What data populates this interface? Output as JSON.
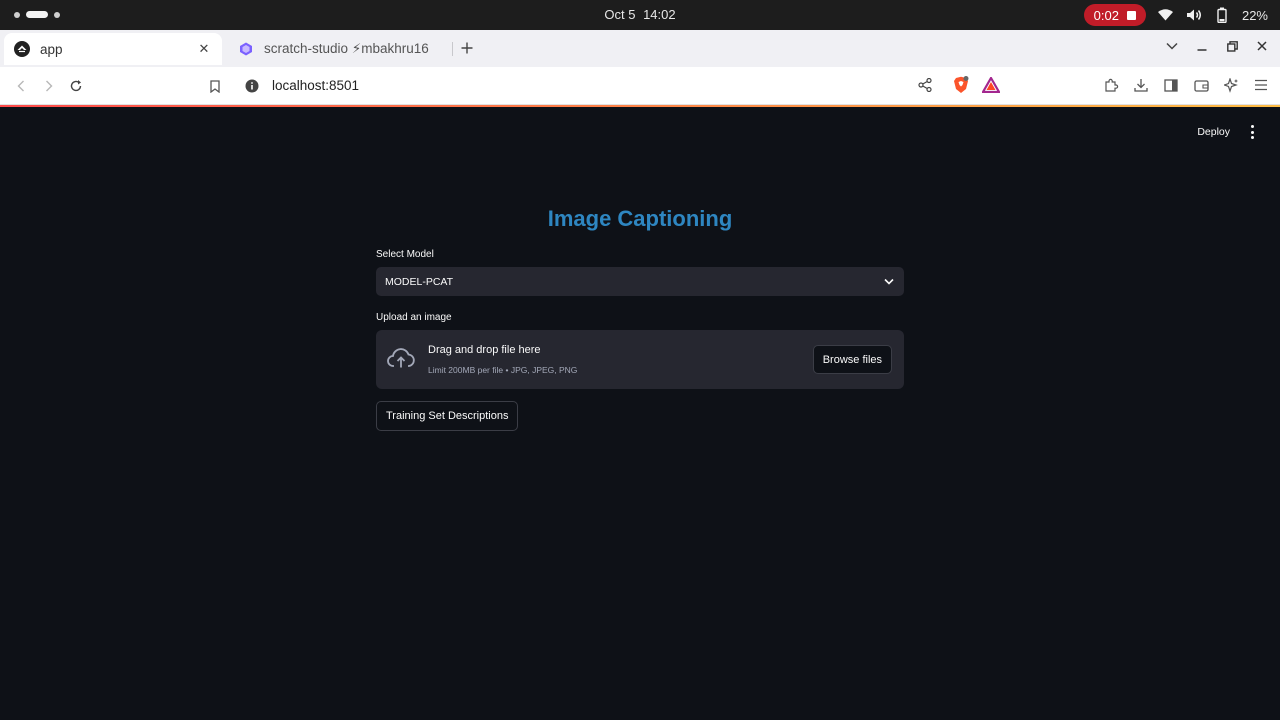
{
  "os": {
    "date": "Oct 5",
    "time": "14:02",
    "recording_time": "0:02",
    "battery": "22%"
  },
  "browser": {
    "tabs": [
      {
        "title": "app",
        "active": true
      },
      {
        "title": "scratch-studio ⚡mbakhru16",
        "active": false
      }
    ],
    "url": "localhost:8501"
  },
  "app": {
    "header": {
      "deploy_label": "Deploy"
    },
    "title": "Image Captioning",
    "model_select": {
      "label": "Select Model",
      "value": "MODEL-PCAT"
    },
    "uploader": {
      "label": "Upload an image",
      "drop_text": "Drag and drop file here",
      "limit_text": "Limit 200MB per file • JPG, JPEG, PNG",
      "browse_label": "Browse files"
    },
    "training_button_label": "Training Set Descriptions"
  },
  "colors": {
    "title": "#2e86c1",
    "background": "#0e1117",
    "widget": "#262730",
    "record": "#c01c28"
  }
}
